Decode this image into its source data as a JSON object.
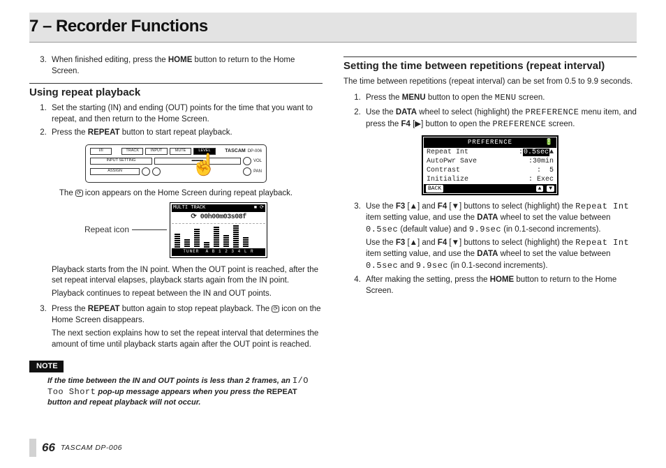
{
  "chapter": "7 – Recorder Functions",
  "left": {
    "top_steps_start": 3,
    "top_steps": [
      {
        "pre": "When finished editing, press the ",
        "b": "HOME",
        "post": " button to return to the Home Screen."
      }
    ],
    "section1": "Using repeat playback",
    "s1_steps": [
      {
        "text": "Set the starting (IN) and ending (OUT) points for the time that you want to repeat, and then return to the Home Screen."
      },
      {
        "pre": "Press the ",
        "b": "REPEAT",
        "post": " button to start repeat playback."
      }
    ],
    "device": {
      "brand": "TASCAM",
      "model": "DP-006",
      "labels": [
        "I/II",
        "TRACK",
        "INPUT",
        "MUTE",
        "LEVEL"
      ],
      "row2": [
        "INPUT SETTING",
        "▬▬▬",
        "VOL"
      ],
      "row3": [
        "ASSIGN",
        "PAN"
      ]
    },
    "fig1_caption_pre": "The ",
    "fig1_caption_post": " icon appears on the Home Screen during repeat playback.",
    "repeat_label": "Repeat icon",
    "screen": {
      "topL": "MULTI TRACK",
      "topR": "■ ⟳",
      "time": "⟳ 00h00m03s08f",
      "bars": [
        60,
        35,
        80,
        25,
        90,
        55,
        95,
        45
      ],
      "bottomL": "TUNER",
      "bottomR": "A B 1 2 3 4 L R"
    },
    "para1": "Playback starts from the IN point. When the OUT point is reached, after the set repeat interval elapses, playback starts again from the IN point.",
    "para2": "Playback continues to repeat between the IN and OUT points.",
    "s1_step3": {
      "pre": "Press the ",
      "b": "REPEAT",
      "mid": " button again to stop repeat playback. The ",
      "post": " icon on the Home Screen disappears."
    },
    "para3": "The next section explains how to set the repeat interval that determines the amount of time until playback starts again after the OUT point is reached.",
    "note_tag": "NOTE",
    "note": {
      "l1": "If the time between the IN and OUT points is less than 2 frames, an ",
      "lcd": "I/O Too Short",
      "l2": " pop-up message appears when you press the ",
      "b": "REPEAT",
      "l3": " button and repeat playback will not occur."
    }
  },
  "right": {
    "section2": "Setting the time between repetitions (repeat interval)",
    "intro": "The time between repetitions (repeat interval) can be set from 0.5 to 9.9 seconds.",
    "steps": [
      {
        "pre": "Press the ",
        "b": "MENU",
        "mid": " button to open the ",
        "lcd": "MENU",
        "post": " screen."
      },
      {
        "pre": "Use the ",
        "b": "DATA",
        "mid": " wheel to select (highlight) the ",
        "lcd": "PREFERENCE",
        "mid2": " menu item, and press the ",
        "b2": "F4",
        "glyph": " [▶] button to open the ",
        "lcd2": "PREFERENCE",
        "post": " screen."
      }
    ],
    "pref_screen": {
      "title": "PREFERENCE",
      "title_r": "🔋",
      "lines": [
        {
          "k": "Repeat Int",
          "v": "0.5sec",
          "hl": true,
          "arrow": "▲"
        },
        {
          "k": "AutoPwr Save",
          "v": "30min"
        },
        {
          "k": "Contrast",
          "v": "5"
        },
        {
          "k": "Initialize",
          "v": "Exec"
        }
      ],
      "bottomL": "BACK",
      "bottomR": "▲  ▼"
    },
    "step3a": {
      "pre": "Use the ",
      "b1": "F3",
      "g1": " [▲] and ",
      "b2": "F4",
      "g2": " [▼] buttons to select (highlight) the ",
      "lcd1": "Repeat Int",
      "mid": " item setting value, and use the ",
      "b3": "DATA",
      "mid2": " wheel to set the value between ",
      "lcd2": "0.5sec",
      "mid3": " (default value) and ",
      "lcd3": "9.9sec",
      "post": " (in 0.1-second increments)."
    },
    "step3b": {
      "pre": "Use the ",
      "b1": "F3",
      "g1": " [▲] and ",
      "b2": "F4",
      "g2": " [▼] buttons to select (highlight) the ",
      "lcd1": "Repeat Int",
      "mid": " item setting value, and use the ",
      "b3": "DATA",
      "mid2": " wheel to set the value between ",
      "lcd2": "0.5sec",
      "mid3": " and ",
      "lcd3": "9.9sec",
      "post": " (in 0.1-second increments)."
    },
    "step4": {
      "pre": "After making the setting, press the ",
      "b": "HOME",
      "post": " button to return to the Home Screen."
    }
  },
  "footer": {
    "page": "66",
    "model": "TASCAM  DP-006"
  }
}
